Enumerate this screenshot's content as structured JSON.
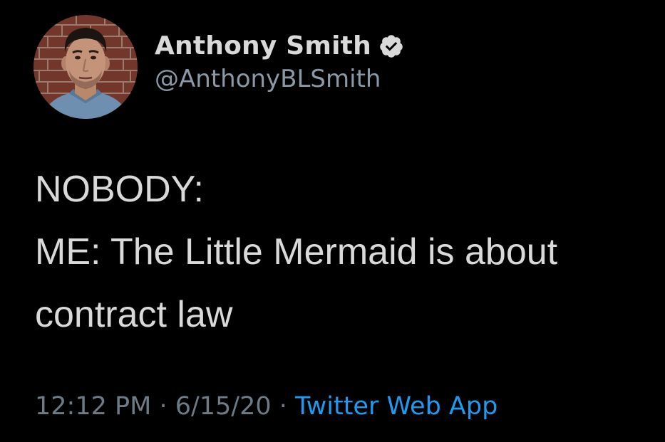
{
  "author": {
    "display_name": "Anthony Smith",
    "handle": "@AnthonyBLSmith",
    "verified": true
  },
  "tweet": {
    "lines": [
      "NOBODY:",
      "ME: The Little Mermaid is about",
      "contract law"
    ]
  },
  "meta": {
    "time": "12:12 PM",
    "date": "6/15/20",
    "separator": "·",
    "source": "Twitter Web App"
  },
  "colors": {
    "background": "#000000",
    "text": "#d9d9d9",
    "muted": "#8b98a5",
    "link": "#1d9bf0"
  },
  "icons": {
    "verified": "verified-badge-icon",
    "avatar": "profile-photo"
  }
}
